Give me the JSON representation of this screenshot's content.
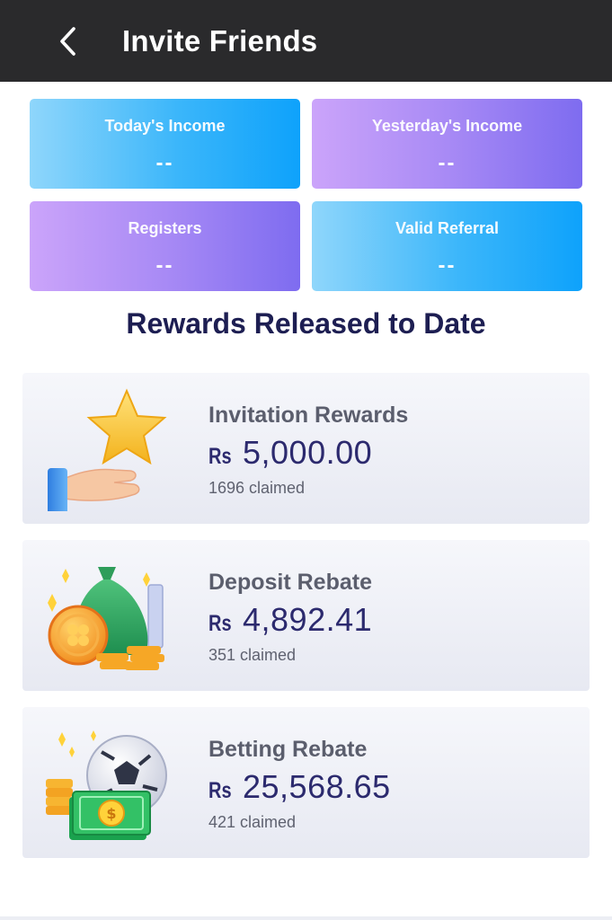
{
  "header": {
    "title": "Invite Friends"
  },
  "stats": [
    {
      "label": "Today's Income",
      "value": "--"
    },
    {
      "label": "Yesterday's Income",
      "value": "--"
    },
    {
      "label": "Registers",
      "value": "--"
    },
    {
      "label": "Valid Referral",
      "value": "--"
    }
  ],
  "section": {
    "title": "Rewards Released to Date"
  },
  "rewards": [
    {
      "title": "Invitation Rewards",
      "currency": "Rs",
      "amount": "5,000.00",
      "claimed": "1696 claimed",
      "icon": "hand-star-icon"
    },
    {
      "title": "Deposit Rebate",
      "currency": "Rs",
      "amount": "4,892.41",
      "claimed": "351 claimed",
      "icon": "money-bag-icon"
    },
    {
      "title": "Betting Rebate",
      "currency": "Rs",
      "amount": "25,568.65",
      "claimed": "421 claimed",
      "icon": "soccer-cash-icon"
    }
  ],
  "colors": {
    "header_bg": "#2a2a2c",
    "title_navy": "#1d1e52",
    "amount_navy": "#2c2a6e",
    "blue_accent": "#0ea2fb",
    "purple_accent": "#7e6cf0"
  }
}
